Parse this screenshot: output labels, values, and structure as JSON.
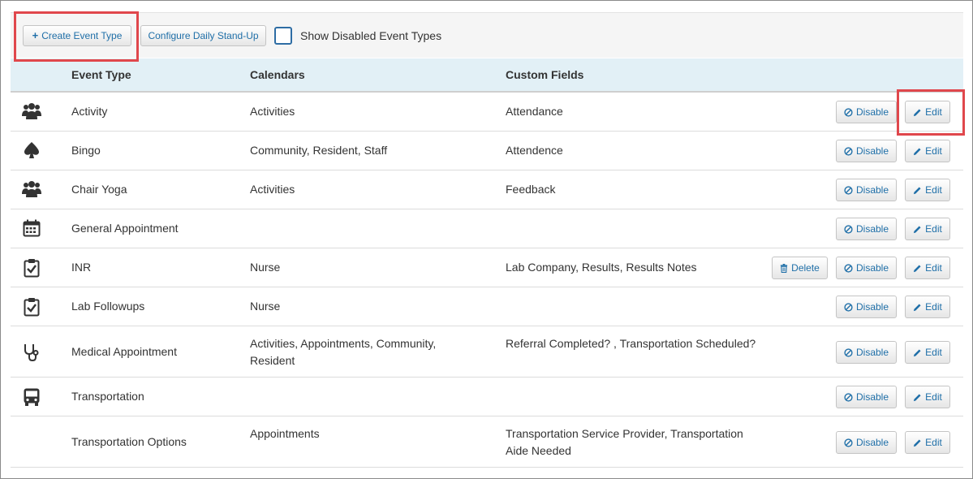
{
  "toolbar": {
    "create_label": "Create Event Type",
    "config_label": "Configure Daily Stand-Up",
    "show_disabled_label": "Show Disabled Event Types"
  },
  "table": {
    "headers": {
      "event_type": "Event Type",
      "calendars": "Calendars",
      "custom_fields": "Custom Fields"
    },
    "actions": {
      "delete": "Delete",
      "disable": "Disable",
      "edit": "Edit"
    },
    "rows": [
      {
        "icon": "group-icon",
        "event_type": "Activity",
        "calendars": "Activities",
        "custom_fields": "Attendance"
      },
      {
        "icon": "spade-icon",
        "event_type": "Bingo",
        "calendars": "Community, Resident, Staff",
        "custom_fields": "Attendence"
      },
      {
        "icon": "group-icon",
        "event_type": "Chair Yoga",
        "calendars": "Activities",
        "custom_fields": "Feedback"
      },
      {
        "icon": "calendar-icon",
        "event_type": "General Appointment",
        "calendars": "",
        "custom_fields": ""
      },
      {
        "icon": "clipboard-check-icon",
        "event_type": "INR",
        "calendars": "Nurse",
        "custom_fields": "Lab Company, Results, Results Notes",
        "deletable": true
      },
      {
        "icon": "clipboard-check-icon",
        "event_type": "Lab Followups",
        "calendars": "Nurse",
        "custom_fields": ""
      },
      {
        "icon": "stethoscope-icon",
        "event_type": "Medical Appointment",
        "calendars": "Activities, Appointments, Community, Resident",
        "custom_fields": "Referral Completed? , Transportation Scheduled?"
      },
      {
        "icon": "bus-icon",
        "event_type": "Transportation",
        "calendars": "",
        "custom_fields": ""
      },
      {
        "icon": "",
        "event_type": "Transportation Options",
        "calendars": "Appointments",
        "custom_fields": "Transportation Service Provider, Transportation Aide Needed"
      }
    ]
  },
  "colors": {
    "accent": "#1f6fa8",
    "header_bg": "#e2f0f6",
    "highlight": "#e0474c"
  }
}
